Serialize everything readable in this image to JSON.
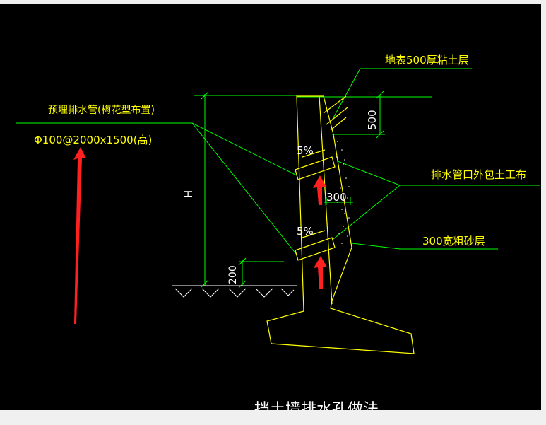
{
  "labels": {
    "surface_layer": "地表500厚粘土层",
    "pipe_title": "预埋排水管(梅花型布置)",
    "pipe_spec": "Φ100@2000x1500(高)",
    "geotextile": "排水管口外包土工布",
    "sand_layer": "300宽粗砂层",
    "dim_500": "500",
    "dim_H": "H",
    "dim_300": "300",
    "dim_200": "200",
    "slope_upper": "5%",
    "slope_lower": "5%",
    "drawing_title": "挡土墙排水孔做法"
  },
  "colors": {
    "background": "#000000",
    "leader_green": "#00ff00",
    "label_yellow": "#ffff00",
    "wall_yellow": "#ffff00",
    "arrow_red": "#ff2020",
    "ground_white": "#ffffff"
  }
}
